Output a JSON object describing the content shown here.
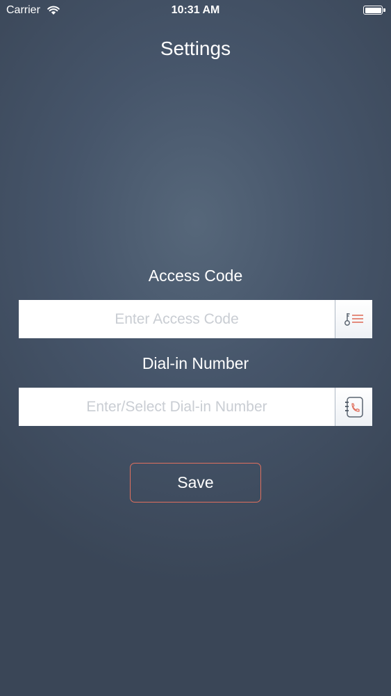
{
  "status_bar": {
    "carrier": "Carrier",
    "time": "10:31 AM",
    "battery_level": 1.0
  },
  "header": {
    "title": "Settings"
  },
  "access_code": {
    "label": "Access Code",
    "placeholder": "Enter Access Code",
    "value": "",
    "button_icon": "key-list-icon"
  },
  "dial_in": {
    "label": "Dial-in Number",
    "placeholder": "Enter/Select Dial-in Number",
    "value": "",
    "button_icon": "phonebook-icon"
  },
  "actions": {
    "save_label": "Save"
  },
  "colors": {
    "accent": "#e0705e",
    "background": "#46556a",
    "placeholder": "#c9cdd3"
  }
}
